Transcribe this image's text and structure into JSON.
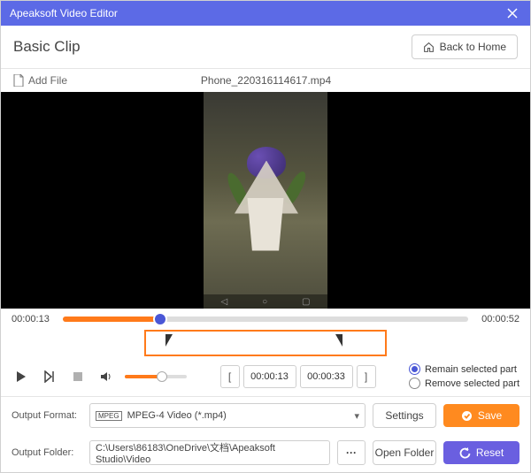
{
  "titlebar": {
    "title": "Apeaksoft Video Editor"
  },
  "header": {
    "title": "Basic Clip",
    "back_label": "Back to Home"
  },
  "file": {
    "add_label": "Add File",
    "name": "Phone_220316114617.mp4"
  },
  "playback": {
    "current": "00:00:13",
    "total": "00:00:52"
  },
  "clip": {
    "start": "00:00:13",
    "end": "00:00:33",
    "option_remain": "Remain selected part",
    "option_remove": "Remove selected part",
    "selected_option": "remain"
  },
  "output": {
    "format_label": "Output Format:",
    "format_value": "MPEG-4 Video (*.mp4)",
    "settings_label": "Settings",
    "folder_label": "Output Folder:",
    "folder_value": "C:\\Users\\86183\\OneDrive\\文档\\Apeaksoft Studio\\Video",
    "open_folder_label": "Open Folder"
  },
  "actions": {
    "save": "Save",
    "reset": "Reset"
  }
}
